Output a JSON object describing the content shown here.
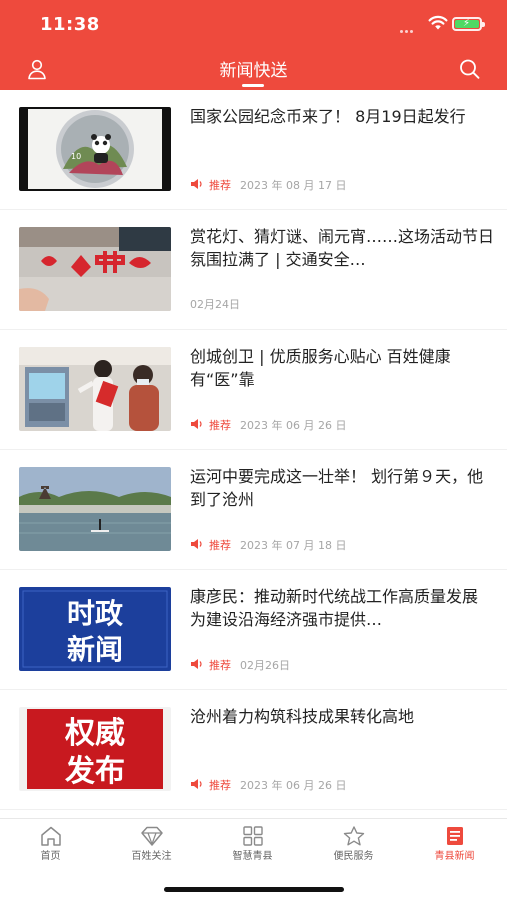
{
  "status_bar": {
    "time": "11:38"
  },
  "navbar": {
    "title": "新闻快送"
  },
  "colors": {
    "brand": "#ee4a3d",
    "muted": "#a6a6a6",
    "text": "#222222"
  },
  "news": [
    {
      "title": "国家公园纪念币来了！ 8月19日起发行",
      "tag": "推荐",
      "date": "2023 年 08 月 17 日",
      "image": "panda-coin-photo"
    },
    {
      "title": "赏花灯、猜灯谜、闹元宵……这场活动节日氛围拉满了 | 交通安全…",
      "tag": "",
      "date": "02月24日",
      "image": "paper-cutting-photo"
    },
    {
      "title": "创城创卫 | 优质服务心贴心 百姓健康有“医”靠",
      "tag": "推荐",
      "date": "2023 年 06 月 26 日",
      "image": "hospital-kiosk-photo"
    },
    {
      "title": "运河中要完成这一壮举！ 划行第９天，他到了沧州",
      "tag": "推荐",
      "date": "2023 年 07 月 18 日",
      "image": "canal-paddleboard-photo"
    },
    {
      "title": "康彦民：推动新时代统战工作高质量发展 为建设沿海经济强市提供…",
      "tag": "推荐",
      "date": "02月26日",
      "image": "current-affairs-banner"
    },
    {
      "title": "沧州着力构筑科技成果转化高地",
      "tag": "推荐",
      "date": "2023 年 06 月 26 日",
      "image": "authoritative-release-banner"
    }
  ],
  "banners": {
    "shizheng": [
      "时政",
      "新闻"
    ],
    "quanwei": [
      "权威",
      "发布"
    ]
  },
  "tabbar": {
    "items": [
      {
        "label": "首页",
        "icon": "home-icon"
      },
      {
        "label": "百姓关注",
        "icon": "diamond-icon"
      },
      {
        "label": "智慧青县",
        "icon": "grid-icon"
      },
      {
        "label": "便民服务",
        "icon": "star-icon"
      },
      {
        "label": "青县新闻",
        "icon": "news-icon",
        "active": true
      }
    ]
  }
}
